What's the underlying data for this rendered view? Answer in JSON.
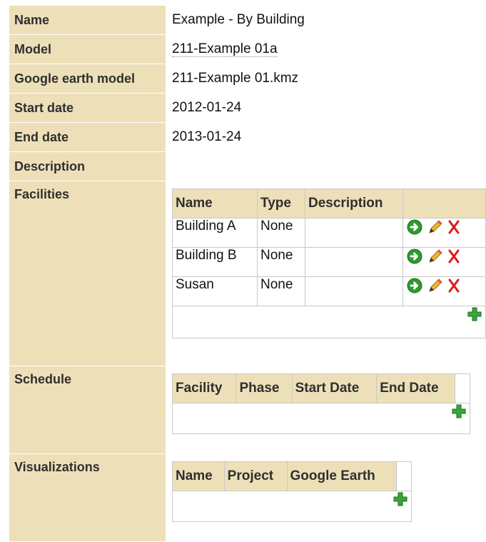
{
  "fields": {
    "name_label": "Name",
    "name_value": "Example - By Building",
    "model_label": "Model",
    "model_value": "211-Example 01a",
    "google_earth_model_label": "Google earth model",
    "google_earth_model_value": "211-Example 01.kmz",
    "start_date_label": "Start date",
    "start_date_value": "2012-01-24",
    "end_date_label": "End date",
    "end_date_value": "2013-01-24",
    "description_label": "Description",
    "description_value": ""
  },
  "facilities": {
    "label": "Facilities",
    "headers": [
      "Name",
      "Type",
      "Description"
    ],
    "rows": [
      {
        "name": "Building A",
        "type": "None",
        "description": ""
      },
      {
        "name": "Building B",
        "type": "None",
        "description": ""
      },
      {
        "name": "Susan",
        "type": "None",
        "description": ""
      }
    ]
  },
  "schedule": {
    "label": "Schedule",
    "headers": [
      "Facility",
      "Phase",
      "Start Date",
      "End Date"
    ]
  },
  "visualizations": {
    "label": "Visualizations",
    "headers": [
      "Name",
      "Project",
      "Google Earth"
    ]
  },
  "icons": {
    "go": "green-arrow-circle-icon",
    "edit": "pencil-icon",
    "delete": "red-x-icon",
    "add": "green-plus-icon"
  },
  "colors": {
    "label_bg": "#ede0b9",
    "border": "#c8c8c8",
    "green": "#2f9a2f",
    "red": "#d81b1b"
  }
}
